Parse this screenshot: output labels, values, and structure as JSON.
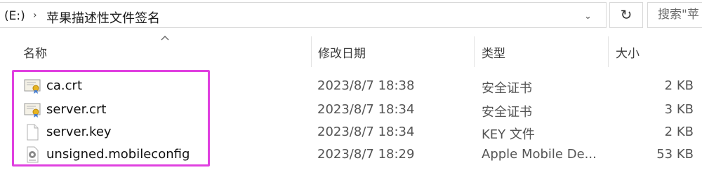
{
  "address_bar": {
    "drive": "(E:)",
    "separator": "›",
    "folder": "苹果描述性文件签名",
    "dropdown": "⌄"
  },
  "refresh_glyph": "↻",
  "search": {
    "text": "搜索\"苹"
  },
  "columns": {
    "name": "名称",
    "date": "修改日期",
    "type": "类型",
    "size": "大小"
  },
  "files": [
    {
      "name": "ca.crt",
      "date": "2023/8/7 18:38",
      "type": "安全证书",
      "size": "2 KB",
      "icon": "certificate-icon"
    },
    {
      "name": "server.crt",
      "date": "2023/8/7 18:34",
      "type": "安全证书",
      "size": "3 KB",
      "icon": "certificate-icon"
    },
    {
      "name": "server.key",
      "date": "2023/8/7 18:34",
      "type": "KEY 文件",
      "size": "2 KB",
      "icon": "blank-file-icon"
    },
    {
      "name": "unsigned.mobileconfig",
      "date": "2023/8/7 18:29",
      "type": "Apple Mobile De...",
      "size": "53 KB",
      "icon": "config-gear-icon"
    }
  ],
  "colors": {
    "highlight": "#e040e0"
  }
}
